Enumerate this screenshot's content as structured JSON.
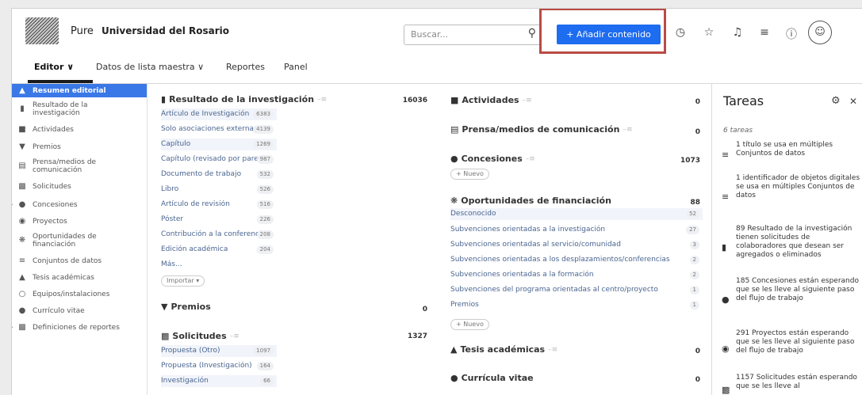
{
  "header": {
    "brand": "Pure",
    "org": "Universidad del Rosario",
    "search_placeholder": "Buscar...",
    "add_button": "+ Añadir contenido",
    "icons": [
      "history-icon",
      "star-icon",
      "notification-bell-icon",
      "list-icon",
      "help-icon",
      "user-avatar-icon"
    ]
  },
  "nav": {
    "editor": "Editor ∨",
    "master": "Datos de lista maestra ∨",
    "reports": "Reportes",
    "panel": "Panel"
  },
  "sidebar": {
    "items": [
      {
        "label": "Resumen editorial",
        "icon": "summary-icon"
      },
      {
        "label": "Resultado de la investigación",
        "icon": "book-icon"
      },
      {
        "label": "Actividades",
        "icon": "briefcase-icon"
      },
      {
        "label": "Premios",
        "icon": "trophy-icon"
      },
      {
        "label": "Prensa/medios de comunicación",
        "icon": "newspaper-icon"
      },
      {
        "label": "Solicitudes",
        "icon": "chart-icon"
      },
      {
        "label": "Concesiones",
        "icon": "money-bag-icon"
      },
      {
        "label": "Proyectos",
        "icon": "project-icon"
      },
      {
        "label": "Oportunidades de financiación",
        "icon": "sprout-icon"
      },
      {
        "label": "Conjuntos de datos",
        "icon": "dataset-icon"
      },
      {
        "label": "Tesis académicas",
        "icon": "graduation-icon"
      },
      {
        "label": "Equipos/instalaciones",
        "icon": "equipment-icon"
      },
      {
        "label": "Currículo vitae",
        "icon": "cv-icon"
      },
      {
        "label": "Definiciones de reportes",
        "icon": "report-definition-icon"
      }
    ]
  },
  "col1": {
    "research": {
      "title": "Resultado de la investigación",
      "count": "16036",
      "rows": [
        {
          "label": "Artículo de Investigación",
          "value": "6383"
        },
        {
          "label": "Solo asociaciones externas",
          "value": "4139"
        },
        {
          "label": "Capítulo",
          "value": "1269"
        },
        {
          "label": "Capítulo (revisado por pares)",
          "value": "987"
        },
        {
          "label": "Documento de trabajo",
          "value": "532"
        },
        {
          "label": "Libro",
          "value": "526"
        },
        {
          "label": "Artículo de revisión",
          "value": "516"
        },
        {
          "label": "Póster",
          "value": "226"
        },
        {
          "label": "Contribución a la conferencia",
          "value": "208"
        },
        {
          "label": "Edición académica",
          "value": "204"
        }
      ],
      "more": "Más...",
      "import": "Importar ▾"
    },
    "awards": {
      "title": "Premios",
      "count": "0"
    },
    "applications": {
      "title": "Solicitudes",
      "count": "1327",
      "rows": [
        {
          "label": "Propuesta (Otro)",
          "value": "1097"
        },
        {
          "label": "Propuesta (Investigación)",
          "value": "164"
        },
        {
          "label": "Investigación",
          "value": "66"
        }
      ]
    }
  },
  "col2": {
    "activities": {
      "title": "Actividades",
      "count": "0"
    },
    "press": {
      "title": "Prensa/medios de comunicación",
      "count": "0"
    },
    "grants": {
      "title": "Concesiones",
      "count": "1073",
      "new": "+ Nuevo"
    },
    "funding": {
      "title": "Oportunidades de financiación",
      "count": "88",
      "rows": [
        {
          "label": "Desconocido",
          "value": "52"
        },
        {
          "label": "Subvenciones orientadas a la investigación",
          "value": "27"
        },
        {
          "label": "Subvenciones orientadas al servicio/comunidad",
          "value": "3"
        },
        {
          "label": "Subvenciones orientadas a los desplazamientos/conferencias",
          "value": "2"
        },
        {
          "label": "Subvenciones orientadas a la formación",
          "value": "2"
        },
        {
          "label": "Subvenciones del programa orientadas al centro/proyecto",
          "value": "1"
        },
        {
          "label": "Premios",
          "value": "1"
        }
      ],
      "new": "+ Nuevo"
    },
    "theses": {
      "title": "Tesis académicas",
      "count": "0"
    },
    "cv": {
      "title": "Currícula vitae",
      "count": "0"
    }
  },
  "tasks": {
    "title": "Tareas",
    "count": "6 tareas",
    "items": [
      {
        "icon": "dataset-icon",
        "text": "1 título se usa en múltiples Conjuntos de datos"
      },
      {
        "icon": "dataset-icon",
        "text": "1 identificador de objetos digitales se usa en múltiples Conjuntos de datos"
      },
      {
        "icon": "book-icon",
        "text": "89 Resultado de la investigación tienen solicitudes de colaboradores que desean ser agregados o eliminados"
      },
      {
        "icon": "money-bag-icon",
        "text": "185 Concesiones están esperando que se les lleve al siguiente paso del flujo de trabajo"
      },
      {
        "icon": "project-icon",
        "text": "291 Proyectos están esperando que se les lleve al siguiente paso del flujo de trabajo"
      },
      {
        "icon": "chart-icon",
        "text": "1157 Solicitudes están esperando que se les lleve al"
      }
    ]
  }
}
